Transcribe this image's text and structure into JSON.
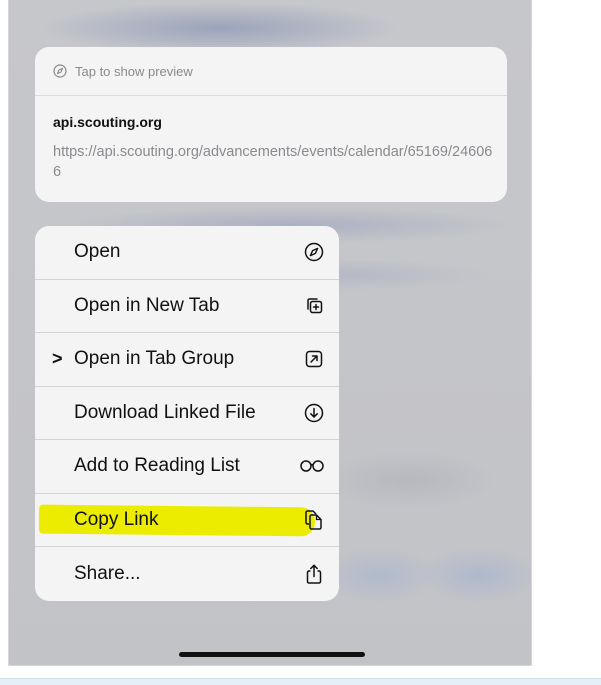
{
  "preview": {
    "tap_text": "Tap to show preview",
    "tap_icon": "compass-icon",
    "host": "api.scouting.org",
    "url": "https://api.scouting.org/advancements/events/calendar/65169/246066"
  },
  "menu": {
    "items": [
      {
        "label": "Open",
        "icon": "compass-icon"
      },
      {
        "label": "Open in New Tab",
        "icon": "plus-square-on-square-icon"
      },
      {
        "label": "Open in Tab Group",
        "icon": "arrow-up-right-square-icon",
        "submenu": true
      },
      {
        "label": "Download Linked File",
        "icon": "arrow-down-circle-icon"
      },
      {
        "label": "Add to Reading List",
        "icon": "eyeglasses-icon"
      },
      {
        "label": "Copy Link",
        "icon": "doc-on-doc-icon",
        "highlighted": true
      },
      {
        "label": "Share...",
        "icon": "share-icon"
      }
    ],
    "submenu_chevron": ">"
  },
  "colors": {
    "highlight": "#ecec00",
    "menu_background": "#f4f4f5",
    "backdrop": "#c4c5c9"
  }
}
